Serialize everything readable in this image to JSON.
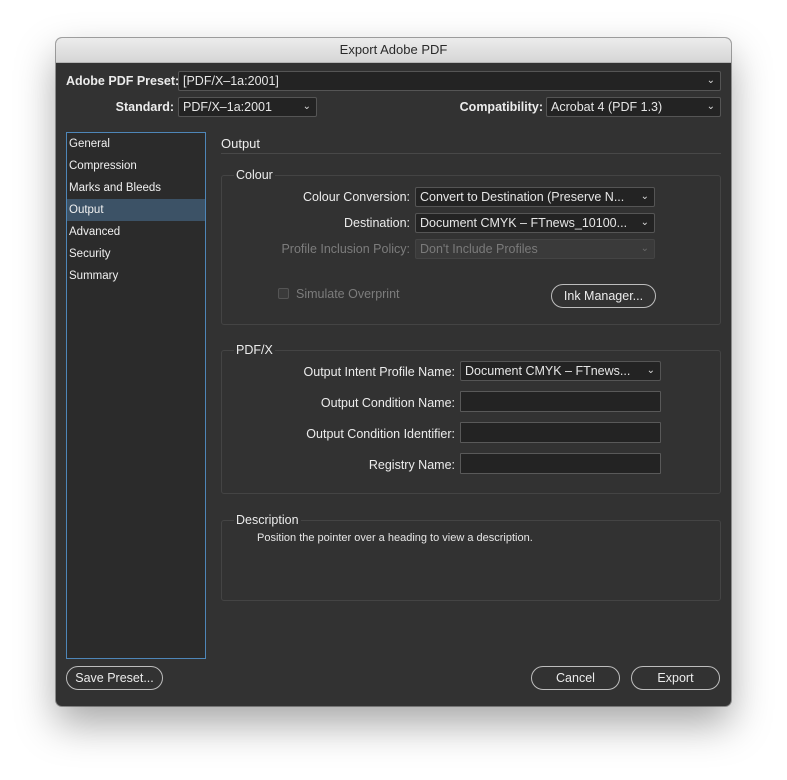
{
  "window": {
    "title": "Export Adobe PDF"
  },
  "header": {
    "preset_label": "Adobe PDF Preset:",
    "preset_value": "[PDF/X–1a:2001]",
    "standard_label": "Standard:",
    "standard_value": "PDF/X–1a:2001",
    "compat_label": "Compatibility:",
    "compat_value": "Acrobat 4 (PDF 1.3)"
  },
  "sidebar": {
    "items": [
      {
        "label": "General"
      },
      {
        "label": "Compression"
      },
      {
        "label": "Marks and Bleeds"
      },
      {
        "label": "Output"
      },
      {
        "label": "Advanced"
      },
      {
        "label": "Security"
      },
      {
        "label": "Summary"
      }
    ],
    "selected": "Output"
  },
  "main": {
    "title": "Output",
    "colour": {
      "title": "Colour",
      "conversion_label": "Colour Conversion:",
      "conversion_value": "Convert to Destination (Preserve N...",
      "destination_label": "Destination:",
      "destination_value": "Document CMYK – FTnews_10100...",
      "profile_label": "Profile Inclusion Policy:",
      "profile_value": "Don't Include Profiles",
      "simulate_label": "Simulate Overprint",
      "simulate_checked": false,
      "ink_button": "Ink Manager..."
    },
    "pdfx": {
      "title": "PDF/X",
      "intent_label": "Output Intent Profile Name:",
      "intent_value": "Document CMYK – FTnews...",
      "cond_name_label": "Output Condition Name:",
      "cond_name_value": "",
      "cond_id_label": "Output Condition Identifier:",
      "cond_id_value": "",
      "registry_label": "Registry Name:",
      "registry_value": ""
    },
    "description": {
      "title": "Description",
      "text": "Position the pointer over a heading to view a description."
    }
  },
  "footer": {
    "save_preset": "Save Preset...",
    "cancel": "Cancel",
    "export": "Export"
  }
}
